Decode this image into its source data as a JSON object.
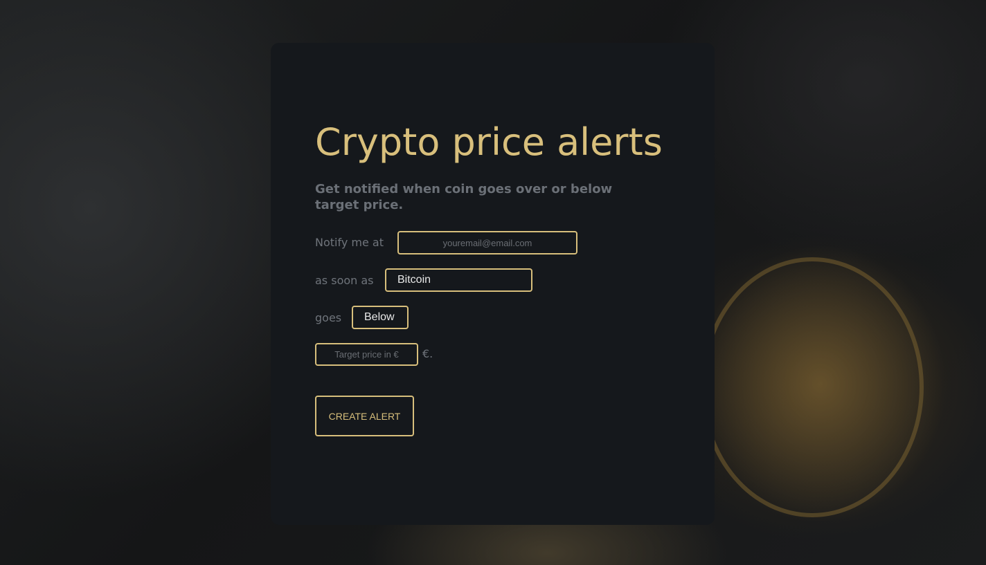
{
  "header": {
    "title": "Crypto price alerts",
    "subtitle": "Get notified when coin goes over or below target price."
  },
  "form": {
    "notify_label": "Notify me at",
    "email_placeholder": "youremail@email.com",
    "email_value": "",
    "as_soon_as_label": "as soon as",
    "coin_selected": "Bitcoin",
    "goes_label": "goes",
    "direction_selected": "Below",
    "price_placeholder": "Target price in €",
    "price_value": "",
    "currency_suffix": "€.",
    "submit_label": "CREATE ALERT"
  },
  "colors": {
    "accent": "#d8bf7c",
    "panel": "#15181c",
    "muted_text": "#6f747b"
  }
}
